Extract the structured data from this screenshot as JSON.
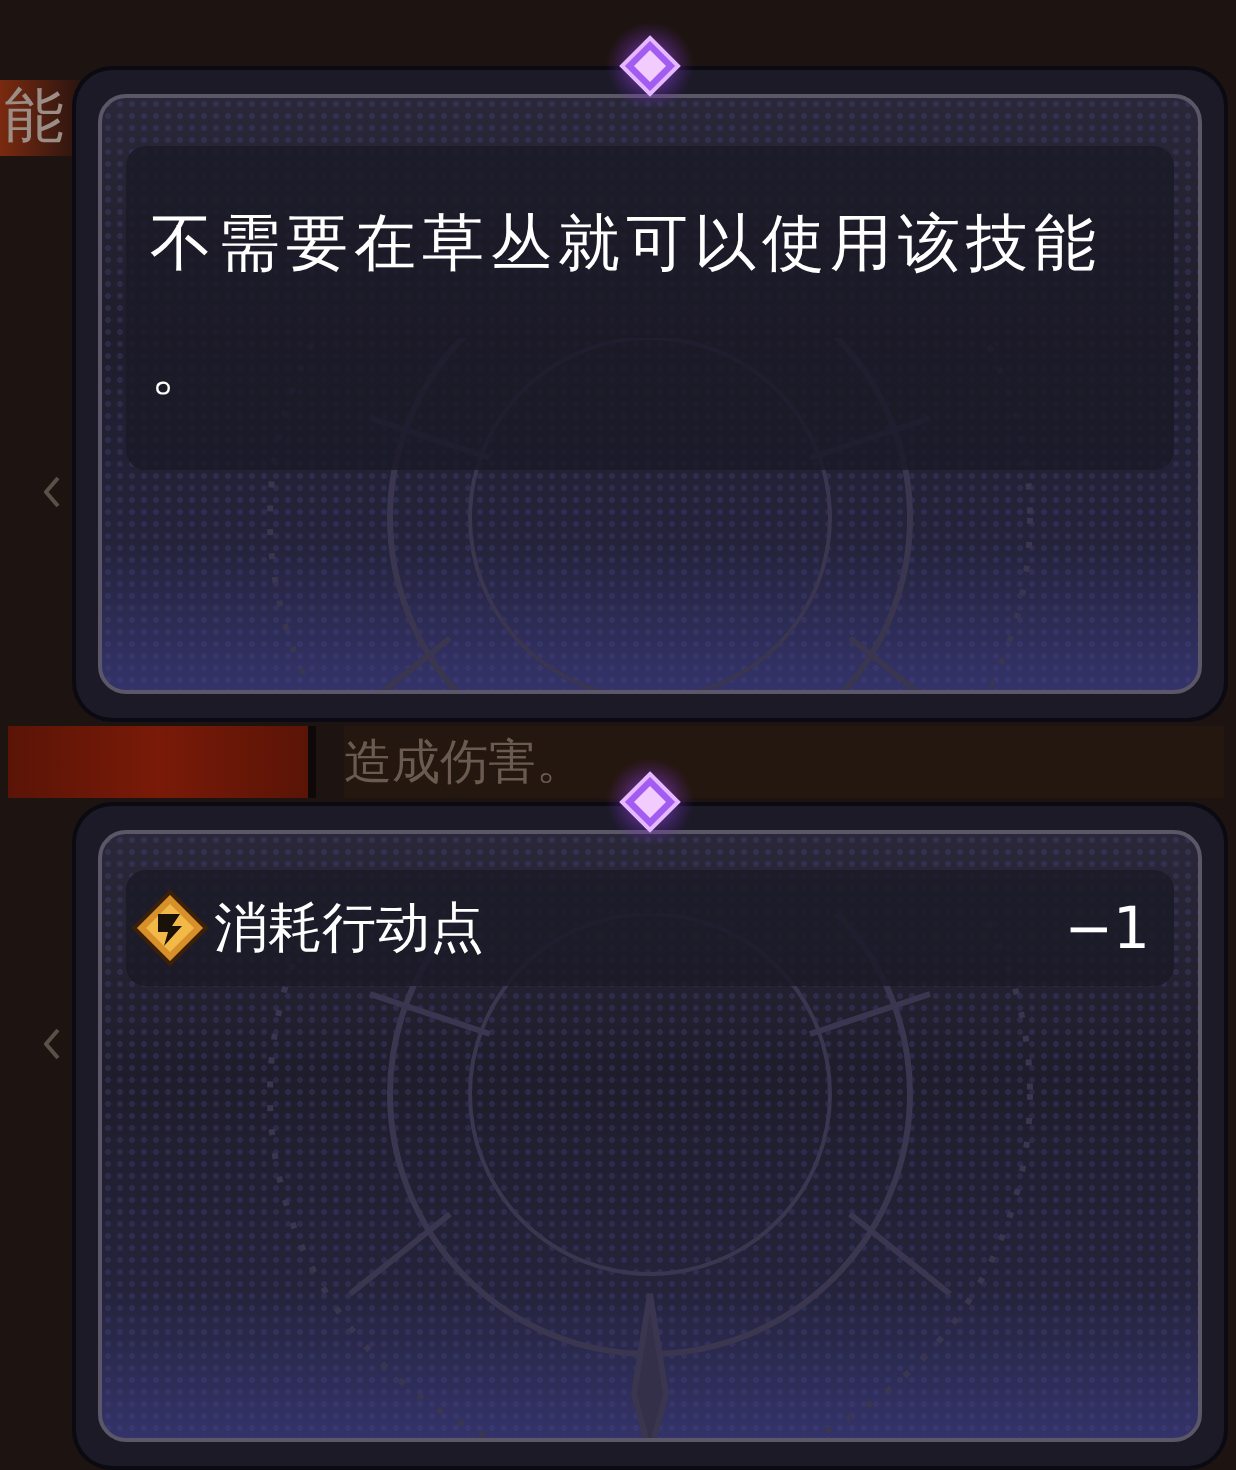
{
  "backdrop": {
    "side_label": "能",
    "effect_text": "造成伤害。"
  },
  "description_panel": {
    "text": "不需要在草丛就可以使用该技能。"
  },
  "cost_panel": {
    "label": "消耗行动点",
    "value": "−1"
  }
}
